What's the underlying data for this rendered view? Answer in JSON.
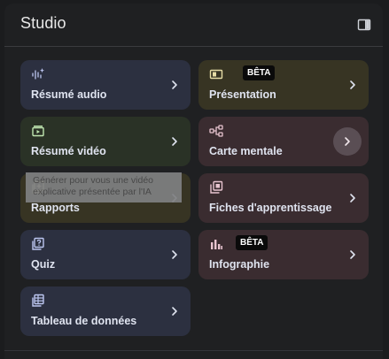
{
  "header": {
    "title": "Studio"
  },
  "cards": [
    {
      "label": "Résumé audio",
      "icon": "audio-waveform-icon",
      "color": "#2c3040"
    },
    {
      "label": "Présentation",
      "icon": "slides-icon",
      "badge": "BÊTA",
      "color": "#373423"
    },
    {
      "label": "Résumé vidéo",
      "icon": "video-icon",
      "color": "#2a3226"
    },
    {
      "label": "Carte mentale",
      "icon": "mind-map-icon",
      "color": "#3a2c30"
    },
    {
      "label": "Rapports",
      "icon": "report-icon",
      "color": "#373423"
    },
    {
      "label": "Fiches d'apprentissage",
      "icon": "flashcards-icon",
      "color": "#3a2c30"
    },
    {
      "label": "Quiz",
      "icon": "quiz-icon",
      "color": "#2c3040"
    },
    {
      "label": "Infographie",
      "icon": "infographic-icon",
      "badge": "BÊTA",
      "color": "#3a2c30"
    },
    {
      "label": "Tableau de données",
      "icon": "table-icon",
      "color": "#2c3040"
    }
  ],
  "tooltip": {
    "line1": "Générer pour vous une vidéo",
    "line2": "explicative présentée par l'IA"
  }
}
